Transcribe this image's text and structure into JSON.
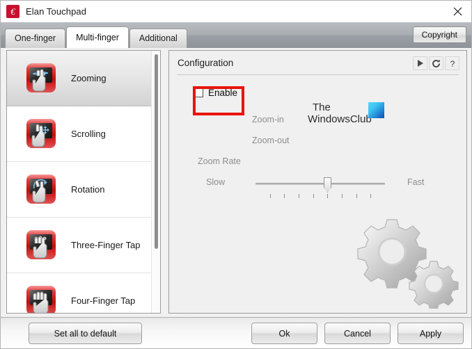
{
  "window": {
    "title": "Elan Touchpad",
    "app_icon": "elan-logo-icon",
    "close_icon": "close-icon"
  },
  "tabs": {
    "items": [
      {
        "label": "One-finger",
        "active": false
      },
      {
        "label": "Multi-finger",
        "active": true
      },
      {
        "label": "Additional",
        "active": false
      }
    ],
    "copyright_label": "Copyright"
  },
  "gesture_list": {
    "items": [
      {
        "label": "Zooming",
        "icon": "two-finger-zoom-icon",
        "selected": true
      },
      {
        "label": "Scrolling",
        "icon": "two-finger-scroll-icon",
        "selected": false
      },
      {
        "label": "Rotation",
        "icon": "two-finger-rotate-icon",
        "selected": false
      },
      {
        "label": "Three-Finger Tap",
        "icon": "three-finger-tap-icon",
        "selected": false
      },
      {
        "label": "Four-Finger Tap",
        "icon": "four-finger-tap-icon",
        "selected": false
      }
    ],
    "scrollbar": "vertical-scrollbar"
  },
  "configuration": {
    "title": "Configuration",
    "header_buttons": [
      {
        "name": "play-icon",
        "glyph": "▶"
      },
      {
        "name": "refresh-icon",
        "glyph": "↻"
      },
      {
        "name": "help-icon",
        "glyph": "?"
      }
    ],
    "enable": {
      "label": "Enable",
      "checked": false,
      "highlighted": true,
      "highlight_color": "#e8140d"
    },
    "zoom_in_label": "Zoom-in",
    "zoom_out_label": "Zoom-out",
    "watermark": {
      "line1": "The",
      "line2": "WindowsClub",
      "logo": "windowsclub-square-icon"
    },
    "zoom_rate": {
      "label": "Zoom Rate",
      "min_label": "Slow",
      "max_label": "Fast",
      "tick_count": 8,
      "value_index": 5
    },
    "decoration_icon": "gears-icon"
  },
  "footer": {
    "set_default_label": "Set all to default",
    "ok_label": "Ok",
    "cancel_label": "Cancel",
    "apply_label": "Apply"
  }
}
